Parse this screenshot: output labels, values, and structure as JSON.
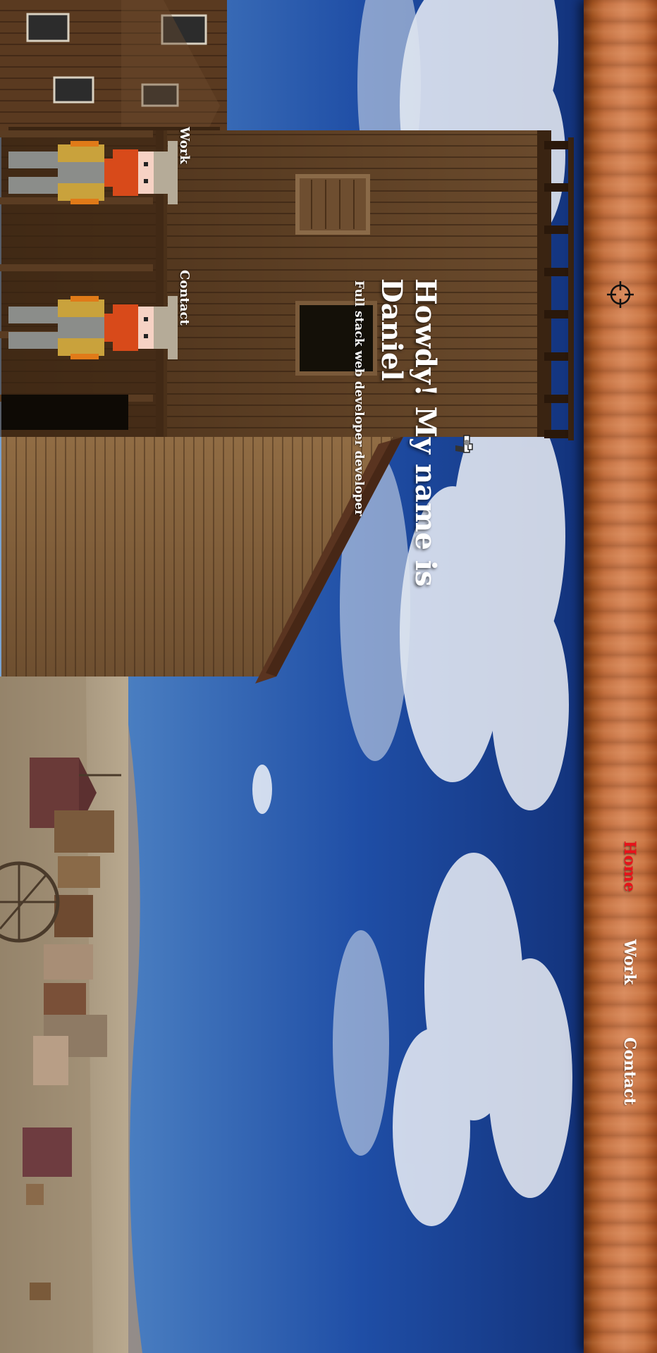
{
  "nav": {
    "links": [
      {
        "label": "Home",
        "active": true
      },
      {
        "label": "Work",
        "active": false
      },
      {
        "label": "Contact",
        "active": false
      }
    ],
    "icon": "crosshair-icon",
    "active_color": "#e8121a"
  },
  "hero": {
    "title": "Howdy! My name is Daniel",
    "subtitle": "Full stack web developer developer",
    "icon": "revolver-icon"
  },
  "characters": [
    {
      "label": "Work",
      "icon": "cowboy-character-icon"
    },
    {
      "label": "Contact",
      "icon": "cowboy-character-icon"
    }
  ],
  "colors": {
    "sky": "#1e4aa0",
    "wood": "#c97442",
    "text": "#ffffff"
  }
}
